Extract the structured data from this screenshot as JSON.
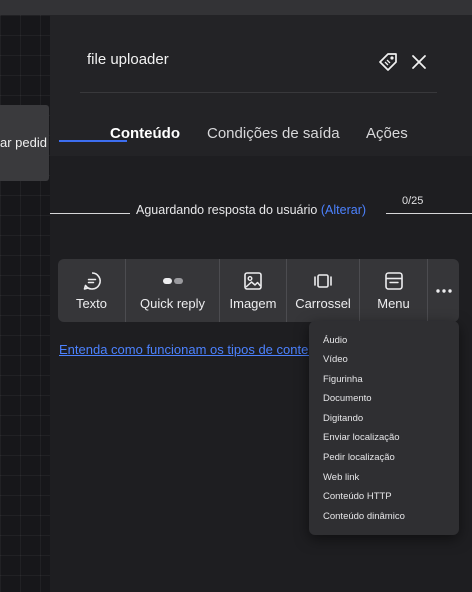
{
  "canvas": {
    "node_label": "ar pedid"
  },
  "panel": {
    "title": "file uploader",
    "icons": {
      "tag": "tag-icon",
      "close": "close-icon"
    },
    "tabs": [
      {
        "label": "Conteúdo",
        "active": true
      },
      {
        "label": "Condições de saída",
        "active": false
      },
      {
        "label": "Ações",
        "active": false
      }
    ]
  },
  "waiting": {
    "text": "Aguardando resposta do usuário",
    "link": "(Alterar)",
    "counter": "0/25"
  },
  "toolbar": {
    "items": [
      {
        "label": "Texto",
        "icon": "chat-bubble-icon"
      },
      {
        "label": "Quick reply",
        "icon": "quick-reply-icon"
      },
      {
        "label": "Imagem",
        "icon": "image-icon"
      },
      {
        "label": "Carrossel",
        "icon": "carousel-icon"
      },
      {
        "label": "Menu",
        "icon": "menu-icon"
      },
      {
        "label": "",
        "icon": "more-icon"
      }
    ]
  },
  "help_link": "Entenda como funcionam os tipos de conteúdo",
  "dropdown": {
    "items": [
      "Áudio",
      "Vídeo",
      "Figurinha",
      "Documento",
      "Digitando",
      "Enviar localização",
      "Pedir localização",
      "Web link",
      "Conteúdo HTTP",
      "Conteúdo dinâmico"
    ]
  },
  "colors": {
    "accent": "#3d6ef0",
    "link": "#4c82ff",
    "panel_bg": "#1e1e21",
    "toolbar_bg": "#363639"
  }
}
